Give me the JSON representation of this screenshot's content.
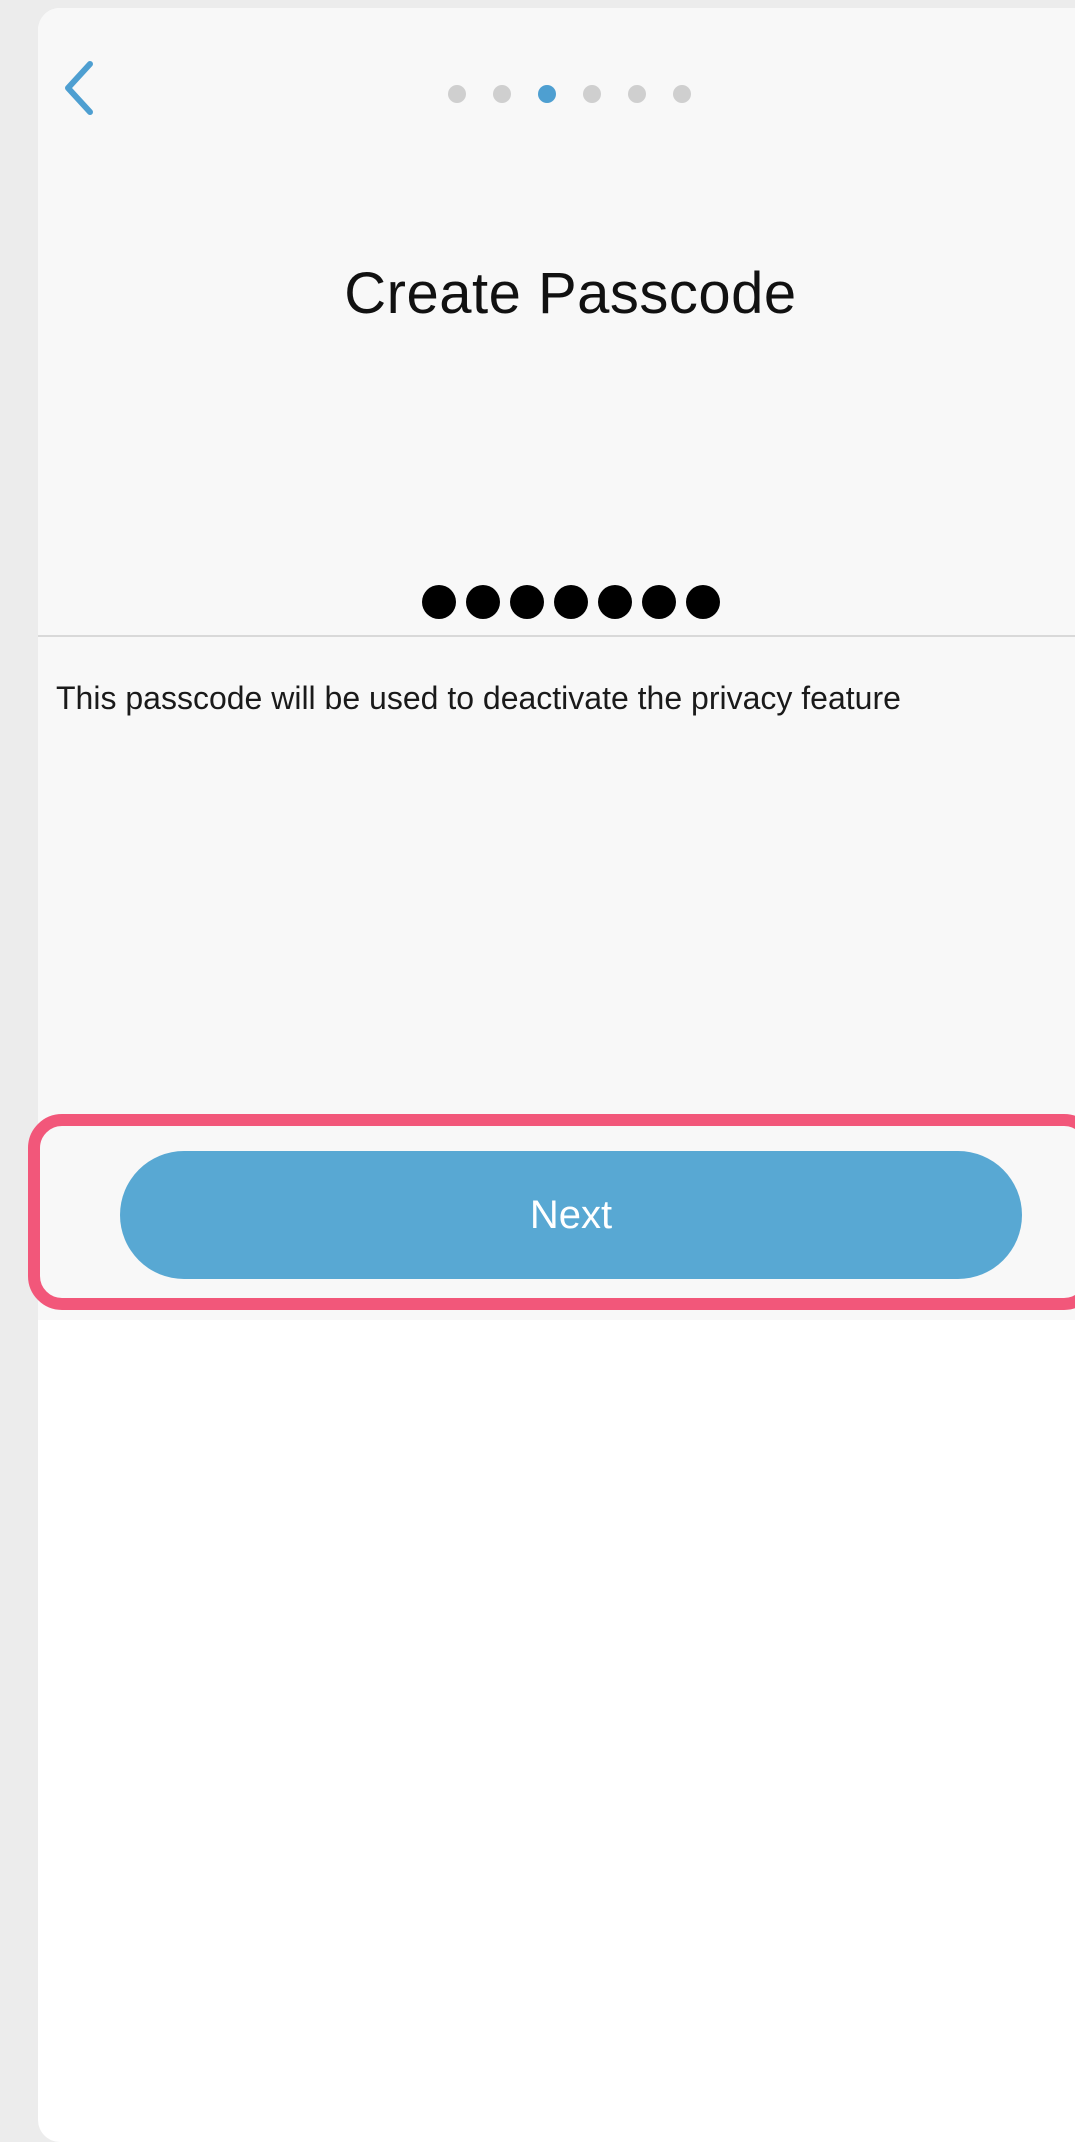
{
  "header": {
    "back_icon": "chevron-left-icon",
    "progress": {
      "total_steps": 6,
      "current_step": 3
    }
  },
  "page": {
    "title": "Create Passcode",
    "passcode_length": 7,
    "hint": "This passcode will be used to deactivate the privacy feature"
  },
  "footer": {
    "next_label": "Next"
  },
  "colors": {
    "accent": "#58a8d3",
    "active_dot": "#4e9fd1",
    "inactive_dot": "#cfcfcf",
    "highlight": "#f2577a"
  }
}
